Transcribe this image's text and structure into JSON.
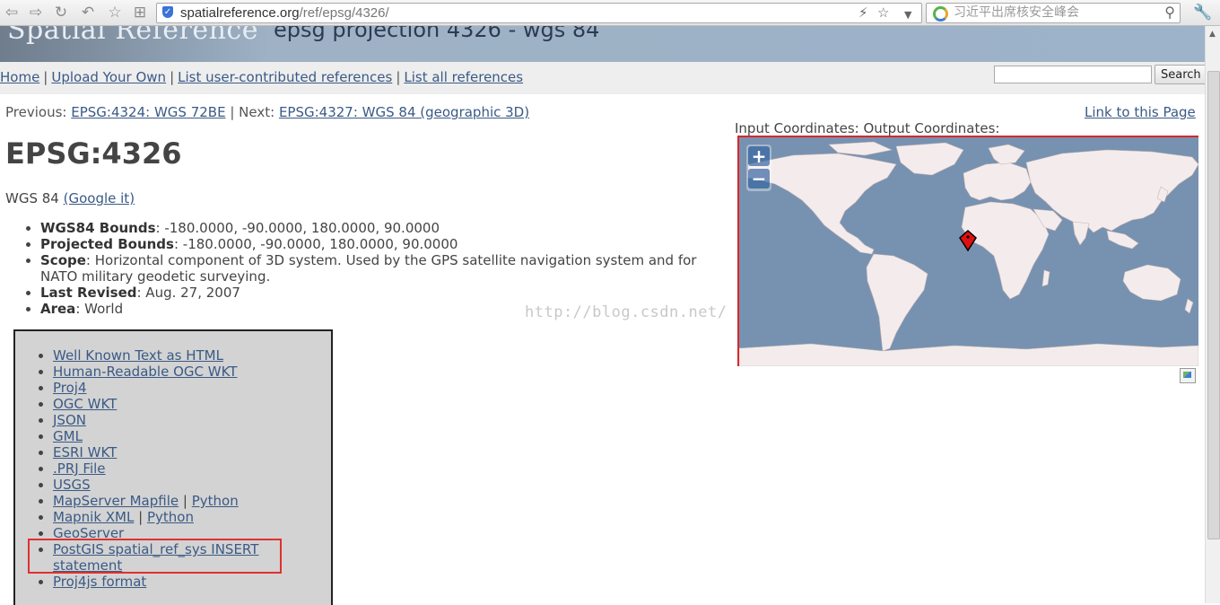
{
  "browser": {
    "url_domain": "spatialreference.org",
    "url_path": "/ref/epsg/4326/",
    "search_placeholder": "习近平出席核安全峰会",
    "icons": [
      "back-icon",
      "forward-icon",
      "reload-icon",
      "undo-icon",
      "star-icon",
      "grid-icon",
      "lightning-icon",
      "bookmark-star-icon",
      "dropdown-arrow-icon",
      "search-icon",
      "wrench-icon"
    ]
  },
  "header": {
    "logo_text": "Spatial Reference",
    "title": "epsg projection 4326 - wgs 84"
  },
  "nav": {
    "links": [
      "Home",
      "Upload Your Own",
      "List user-contributed references",
      "List all references"
    ],
    "search_button": "Search",
    "search_value": ""
  },
  "content": {
    "previous_label": "Previous:",
    "previous_link": "EPSG:4324: WGS 72BE",
    "next_label": "| Next:",
    "next_link": "EPSG:4327: WGS 84 (geographic 3D)",
    "link_to_page": "Link to this Page",
    "title": "EPSG:4326",
    "subtitle_name": "WGS 84",
    "subtitle_link": "(Google it)",
    "properties": [
      {
        "label": "WGS84 Bounds",
        "value": ": -180.0000, -90.0000, 180.0000, 90.0000"
      },
      {
        "label": "Projected Bounds",
        "value": ": -180.0000, -90.0000, 180.0000, 90.0000"
      },
      {
        "label": "Scope",
        "value": ": Horizontal component of 3D system. Used by the GPS satellite navigation system and for NATO military geodetic surveying."
      },
      {
        "label": "Last Revised",
        "value": ": Aug. 27, 2007"
      },
      {
        "label": "Area",
        "value": ": World"
      }
    ],
    "watermark": "http://blog.csdn.net/"
  },
  "formats": {
    "items": [
      [
        "Well Known Text as HTML"
      ],
      [
        "Human-Readable OGC WKT"
      ],
      [
        "Proj4"
      ],
      [
        "OGC WKT"
      ],
      [
        "JSON"
      ],
      [
        "GML"
      ],
      [
        "ESRI WKT"
      ],
      [
        ".PRJ File"
      ],
      [
        "USGS"
      ],
      [
        "MapServer Mapfile",
        "Python"
      ],
      [
        "Mapnik XML",
        "Python"
      ],
      [
        "GeoServer"
      ],
      [
        "PostGIS spatial_ref_sys INSERT statement"
      ],
      [
        "Proj4js format"
      ]
    ]
  },
  "map": {
    "coords_label": "Input Coordinates: Output Coordinates:",
    "zoom_in": "+",
    "zoom_out": "−",
    "ocean_color": "#7792b0",
    "land_color": "#f4ecec",
    "marker_color": "#e01010"
  }
}
